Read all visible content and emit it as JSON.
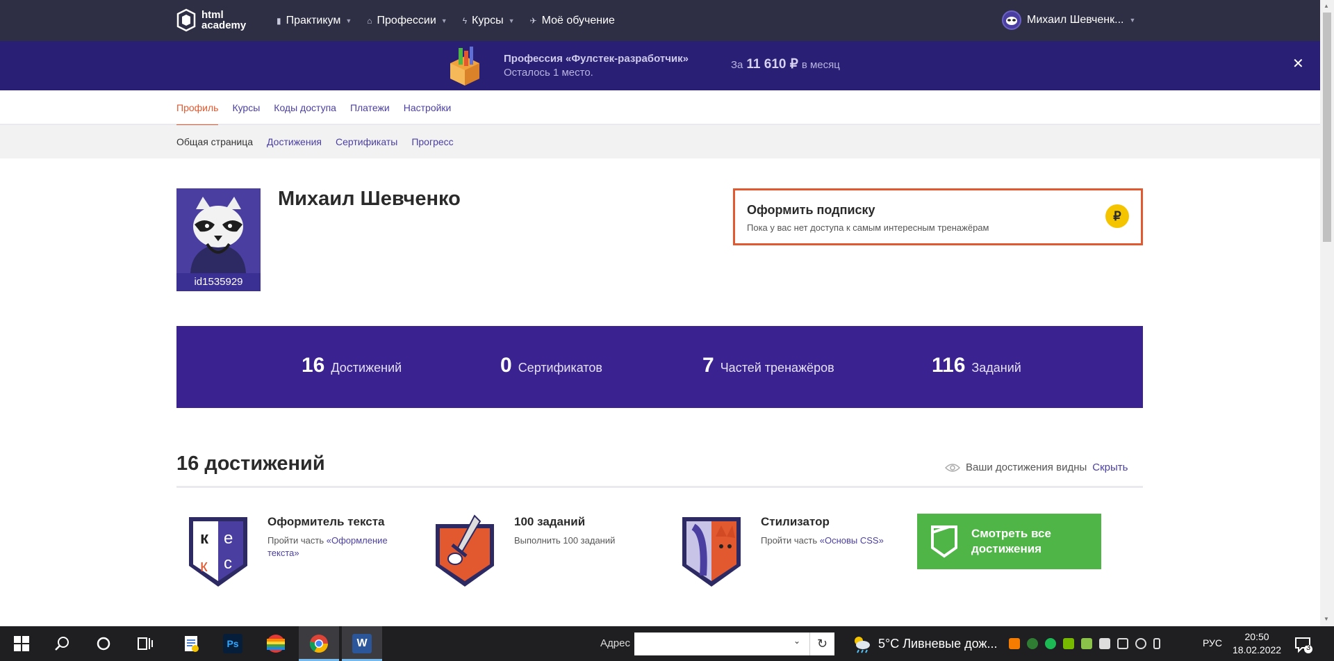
{
  "header": {
    "logo_text_1": "html",
    "logo_text_2": "academy",
    "nav": [
      {
        "label": "Практикум",
        "icon": "chart-icon",
        "has_dropdown": true
      },
      {
        "label": "Профессии",
        "icon": "cap-icon",
        "has_dropdown": true
      },
      {
        "label": "Курсы",
        "icon": "bolt-icon",
        "has_dropdown": true
      },
      {
        "label": "Моё обучение",
        "icon": "rocket-icon",
        "has_dropdown": false
      }
    ],
    "user_name": "Михаил Шевченк..."
  },
  "promo": {
    "title": "Профессия «Фулстек-разработчик»",
    "subtitle": "Осталось 1 место.",
    "price_prefix": "За",
    "price_value": "11 610 ₽",
    "price_suffix": "в месяц",
    "close_label": "✕"
  },
  "profile_tabs": [
    {
      "label": "Профиль",
      "active": true
    },
    {
      "label": "Курсы",
      "active": false
    },
    {
      "label": "Коды доступа",
      "active": false
    },
    {
      "label": "Платежи",
      "active": false
    },
    {
      "label": "Настройки",
      "active": false
    }
  ],
  "sub_tabs": [
    {
      "label": "Общая страница",
      "active": true
    },
    {
      "label": "Достижения",
      "active": false
    },
    {
      "label": "Сертификаты",
      "active": false
    },
    {
      "label": "Прогресс",
      "active": false
    }
  ],
  "profile": {
    "user_id": "id1535929",
    "name": "Михаил Шевченко"
  },
  "subscribe": {
    "title": "Оформить подписку",
    "subtitle": "Пока у вас нет доступа к самым интересным тренажёрам",
    "icon_glyph": "₽"
  },
  "stats": [
    {
      "value": "16",
      "label": "Достижений"
    },
    {
      "value": "0",
      "label": "Сертификатов"
    },
    {
      "value": "7",
      "label": "Частей тренажёров"
    },
    {
      "value": "116",
      "label": "Заданий"
    }
  ],
  "achievements": {
    "title": "16 достижений",
    "visibility_text": "Ваши достижения видны",
    "hide_label": "Скрыть",
    "items": [
      {
        "name": "Оформитель текста",
        "desc_prefix": "Пройти часть ",
        "desc_link": "«Оформление текста»",
        "icon": "kex-badge-icon"
      },
      {
        "name": "100 заданий",
        "desc_prefix": "Выполнить 100 заданий",
        "desc_link": "",
        "icon": "sword-badge-icon"
      },
      {
        "name": "Стилизатор",
        "desc_prefix": "Пройти часть ",
        "desc_link": "«Основы CSS»",
        "icon": "cat-badge-icon"
      }
    ],
    "see_all_label": "Смотреть все достижения"
  },
  "taskbar": {
    "address_label": "Адрес",
    "address_value": "",
    "weather": "5°C  Ливневые дож...",
    "language": "РУС",
    "time": "20:50",
    "date": "18.02.2022",
    "notifications": "3"
  },
  "colors": {
    "header_bg": "#2e2f45",
    "promo_bg": "#291f75",
    "accent_orange": "#e2582f",
    "accent_purple": "#4a3fa1",
    "stats_bg": "#3a2290",
    "green": "#4fb547"
  }
}
